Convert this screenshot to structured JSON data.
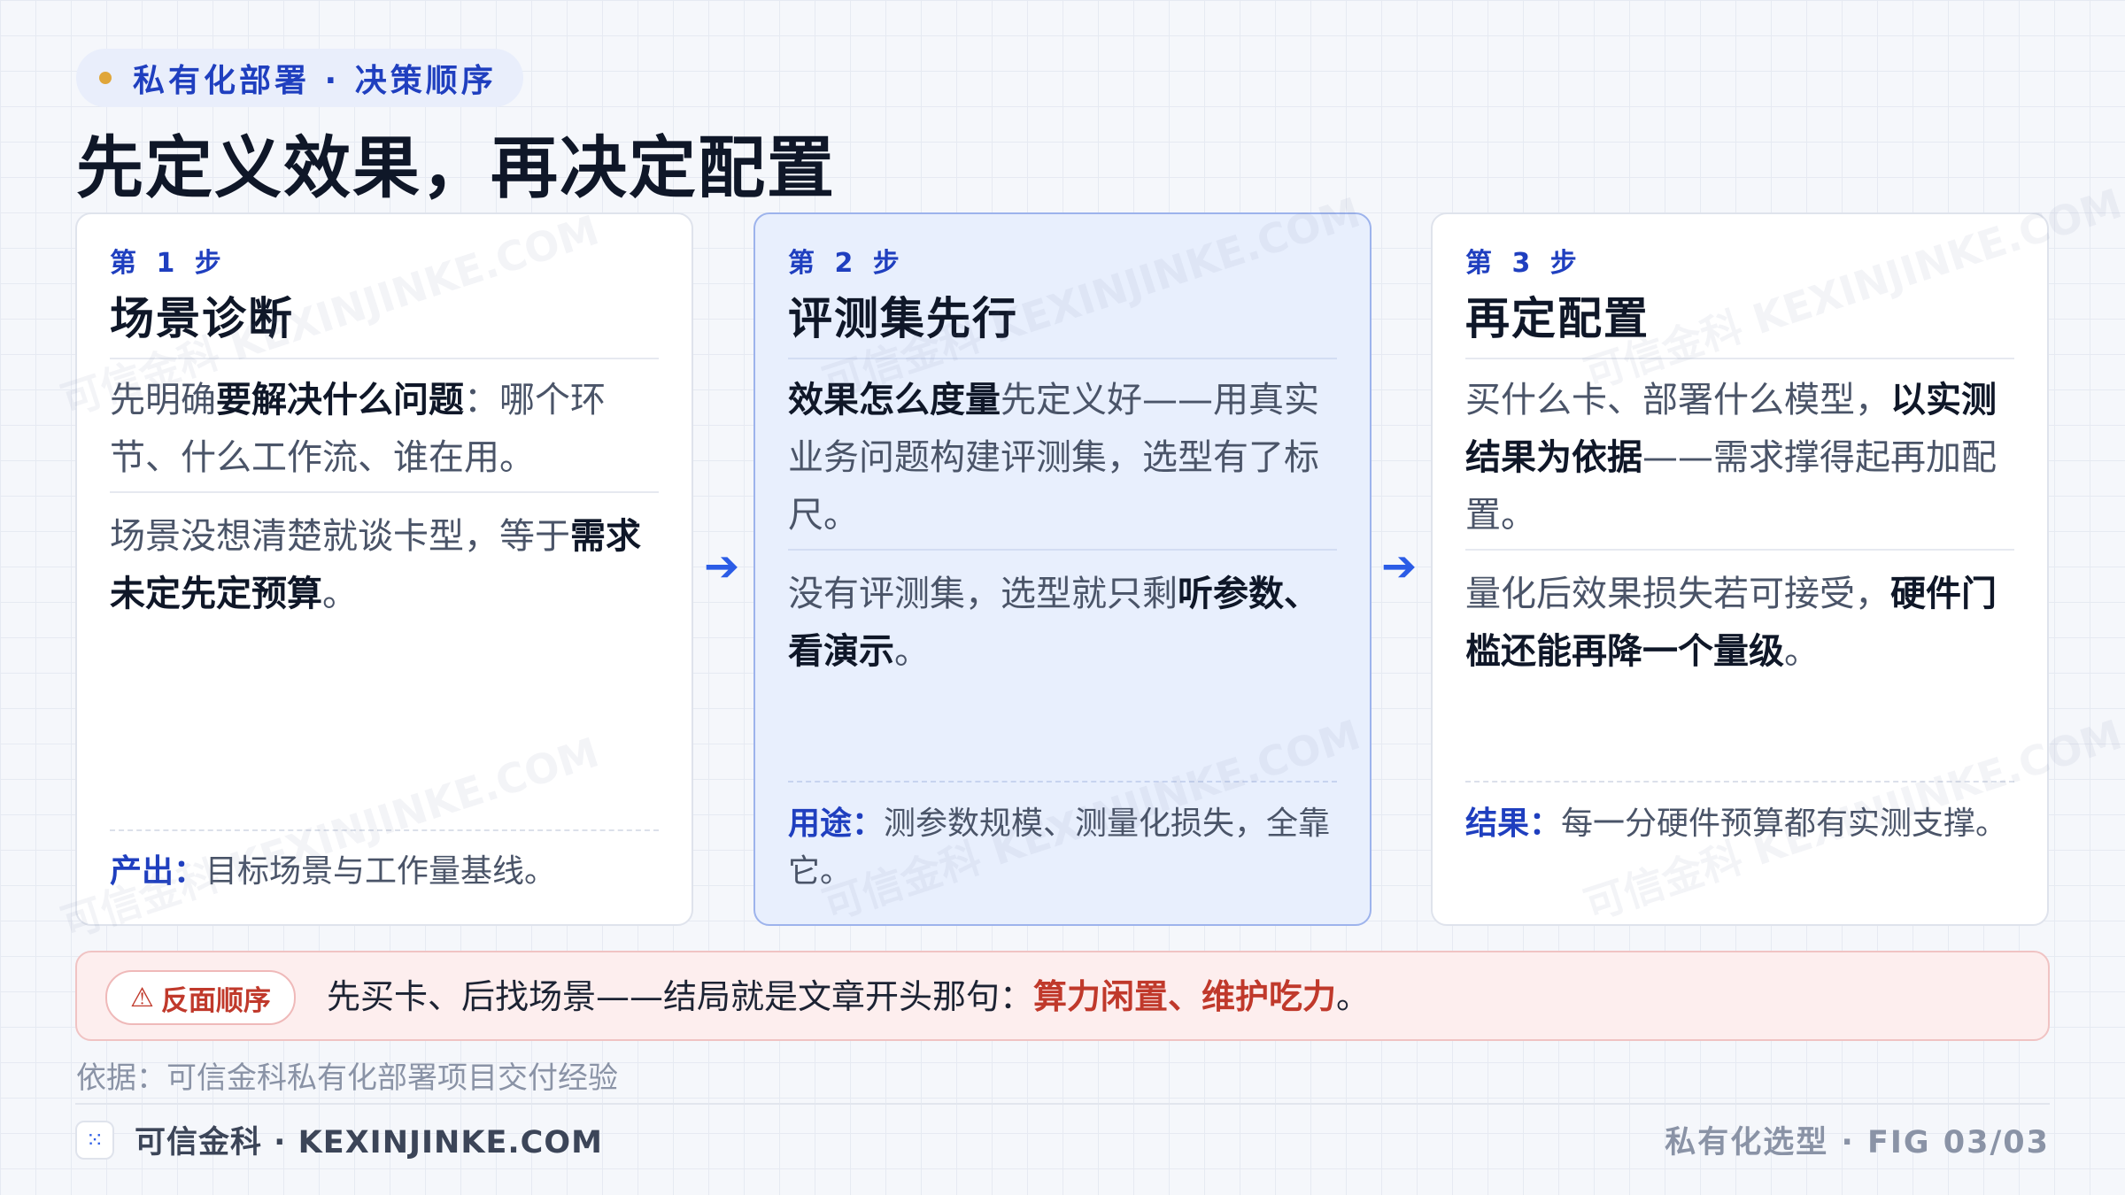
{
  "header": {
    "kicker": "私有化部署 · 决策顺序",
    "title": "先定义效果，再决定配置"
  },
  "steps": [
    {
      "step": "第 1 步",
      "title": "场景诊断",
      "p1_pre": "先明确",
      "p1_bold": "要解决什么问题",
      "p1_post": "：哪个环节、什么工作流、谁在用。",
      "p2_pre": "场景没想清楚就谈卡型，等于",
      "p2_bold": "需求未定先定预算",
      "p2_post": "。",
      "foot_label": "产出：",
      "foot_text": "目标场景与工作量基线。"
    },
    {
      "step": "第 2 步",
      "title": "评测集先行",
      "p1_bold": "效果怎么度量",
      "p1_post": "先定义好——用真实业务问题构建评测集，选型有了标尺。",
      "p2_pre": "没有评测集，选型就只剩",
      "p2_bold": "听参数、看演示",
      "p2_post": "。",
      "foot_label": "用途：",
      "foot_text": "测参数规模、测量化损失，全靠它。"
    },
    {
      "step": "第 3 步",
      "title": "再定配置",
      "p1_pre": "买什么卡、部署什么模型，",
      "p1_bold": "以实测结果为依据",
      "p1_post": "——需求撑得起再加配置。",
      "p2_pre": "量化后效果损失若可接受，",
      "p2_bold": "硬件门槛还能再降一个量级",
      "p2_post": "。",
      "foot_label": "结果：",
      "foot_text": "每一分硬件预算都有实测支撑。"
    }
  ],
  "arrow": "➔",
  "warning": {
    "icon": "⚠",
    "badge": "反面顺序",
    "text": "先买卡、后找场景——结局就是文章开头那句：",
    "emphasis": "算力闲置、维护吃力",
    "end": "。"
  },
  "basis": "依据：可信金科私有化部署项目交付经验",
  "footer": {
    "logo_icon": "⁙",
    "brand": "可信金科 · KEXINJINKE.COM",
    "fig": "私有化选型 · FIG 03/03"
  },
  "watermark": "可信金科 KEXINJINKE.COM",
  "colors": {
    "accent": "#1f3fbf",
    "arrow": "#2b5ce6",
    "warning": "#c0392b",
    "highlight_card": "#e8effd"
  }
}
